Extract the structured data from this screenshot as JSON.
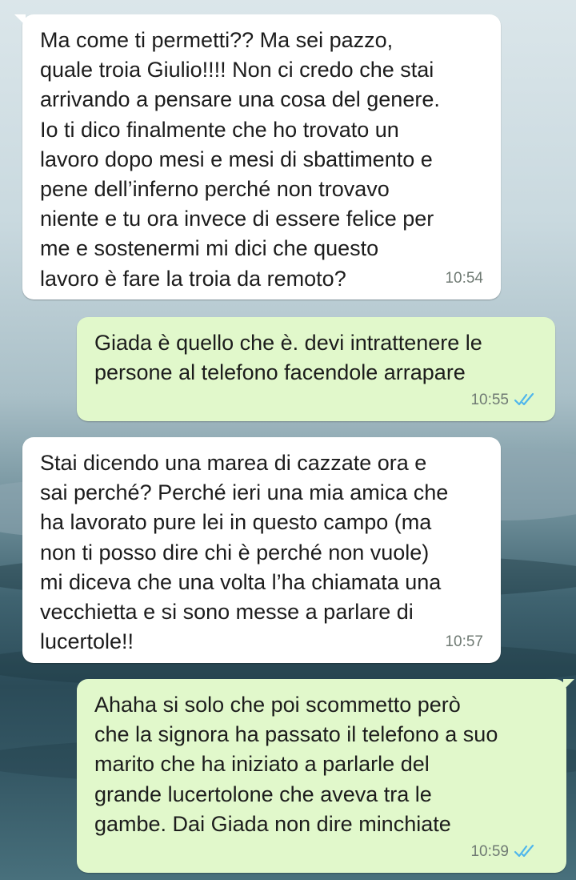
{
  "messages": [
    {
      "direction": "incoming",
      "text": "Ma come ti permetti?? Ma sei pazzo,\nquale troia Giulio!!!! Non ci credo che stai\narrivando a pensare una cosa del genere.\nIo ti dico finalmente che ho trovato un\nlavoro dopo mesi e mesi di sbattimento e\npene dell’inferno perché non trovavo\nniente e tu ora invece di essere felice per\nme e sostenermi mi dici che questo\nlavoro è fare la troia da remoto?",
      "time": "10:54"
    },
    {
      "direction": "outgoing",
      "text": "Giada è quello che è. devi intrattenere le\npersone al telefono facendole arrapare",
      "time": "10:55",
      "status": "read",
      "status_icon": "double-check-icon"
    },
    {
      "direction": "incoming",
      "text": "Stai dicendo una marea di cazzate ora e\nsai perché? Perché ieri una mia amica che\nha lavorato pure lei in questo campo (ma\nnon ti posso dire chi è perché non vuole)\nmi diceva che una volta l’ha chiamata una\nvecchietta e si sono messe a parlare di\nlucertole!!",
      "time": "10:57"
    },
    {
      "direction": "outgoing",
      "text": "Ahaha si solo che poi scommetto però\nche la signora ha passato il telefono a suo\nmarito che ha iniziato a parlarle del\ngrande lucertolone che aveva tra le\ngambe. Dai Giada non dire minchiate",
      "time": "10:59",
      "status": "read",
      "status_icon": "double-check-icon"
    }
  ],
  "colors": {
    "incoming_bubble": "#ffffff",
    "outgoing_bubble": "#e1f8cb",
    "read_ticks": "#4fb6ec",
    "timestamp": "#6f7a73"
  }
}
